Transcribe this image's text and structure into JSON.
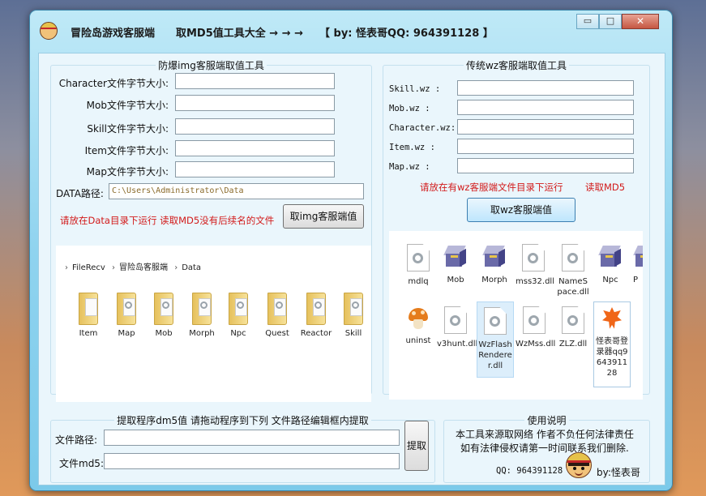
{
  "window": {
    "app_name": "冒险岛游戏客服端",
    "subtitle": "取MD5值工具大全 → → →",
    "author": "【 by: 怪表哥QQ: 964391128 】",
    "controls": {
      "minimize": "▭",
      "maximize": "□",
      "close": "✕"
    }
  },
  "img_panel": {
    "title": "防爆img客服端取值工具",
    "fields": [
      {
        "label": "Character文件字节大小:",
        "value": ""
      },
      {
        "label": "Mob文件字节大小:",
        "value": ""
      },
      {
        "label": "Skill文件字节大小:",
        "value": ""
      },
      {
        "label": "Item文件字节大小:",
        "value": ""
      },
      {
        "label": "Map文件字节大小:",
        "value": ""
      }
    ],
    "data_path_label": "DATA路径:",
    "data_path_value": "C:\\Users\\Administrator\\Data",
    "hint": "请放在Data目录下运行 读取MD5没有后续名的文件",
    "button": "取img客服端值",
    "browser": {
      "breadcrumb": [
        "FileRecv",
        "冒险岛客服端",
        "Data"
      ],
      "folders": [
        "Item",
        "Map",
        "Mob",
        "Morph",
        "Npc",
        "Quest",
        "Reactor",
        "Skill"
      ]
    }
  },
  "wz_panel": {
    "title": "传统wz客服端取值工具",
    "fields": [
      {
        "label": "Skill.wz :",
        "value": ""
      },
      {
        "label": "Mob.wz :",
        "value": ""
      },
      {
        "label": "Character.wz:",
        "value": ""
      },
      {
        "label": "Item.wz :",
        "value": ""
      },
      {
        "label": "Map.wz :",
        "value": ""
      }
    ],
    "hint": "请放在有wz客服端文件目录下运行",
    "hint_link": "读取MD5",
    "button": "取wz客服端值",
    "browser": {
      "row1": [
        "mdlq",
        "Mob",
        "Morph",
        "mss32.dll",
        "NameSpace.dll",
        "Npc",
        "P"
      ],
      "row2": [
        "uninst",
        "v3hunt.dll",
        "WzFlashRenderer.dll",
        "WzMss.dll",
        "ZLZ.dll",
        "怪表哥登录器qq964391128"
      ]
    }
  },
  "extract_panel": {
    "title": "提取程序dm5值 请拖动程序到下列 文件路径编辑框内提取",
    "path_label": "文件路径:",
    "path_value": "",
    "md5_label": "文件md5:",
    "md5_value": "",
    "button": "提取"
  },
  "usage_panel": {
    "title": "使用说明",
    "line1": "本工具来源取网络 作者不负任何法律责任",
    "line2": "如有法律侵权请第一时间联系我们删除.",
    "qq": "QQ: 964391128",
    "by": "by:怪表哥"
  }
}
